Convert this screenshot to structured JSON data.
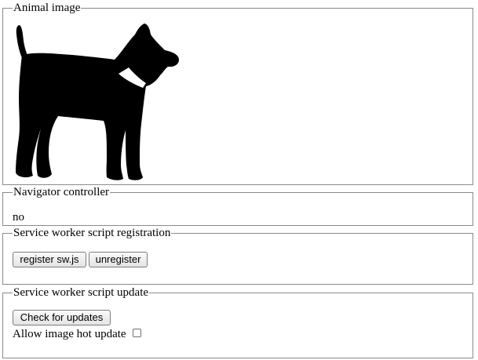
{
  "sections": {
    "image": {
      "legend": "Animal image",
      "icon": "dog-silhouette"
    },
    "controller": {
      "legend": "Navigator controller",
      "value": "no"
    },
    "registration": {
      "legend": "Service worker script registration",
      "register_label": "register sw.js",
      "unregister_label": "unregister"
    },
    "update": {
      "legend": "Service worker script update",
      "check_label": "Check for updates",
      "hot_update_label": "Allow image hot update",
      "hot_update_checked": false
    }
  }
}
